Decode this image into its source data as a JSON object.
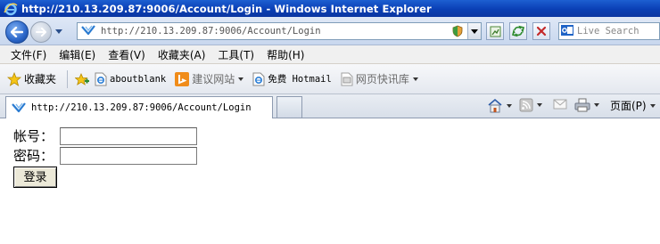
{
  "window": {
    "title": "http://210.13.209.87:9006/Account/Login - Windows Internet Explorer"
  },
  "address_bar": {
    "url": "http://210.13.209.87:9006/Account/Login"
  },
  "search": {
    "placeholder": "Live Search"
  },
  "menu": {
    "items": [
      "文件(F)",
      "编辑(E)",
      "查看(V)",
      "收藏夹(A)",
      "工具(T)",
      "帮助(H)"
    ]
  },
  "favorites_bar": {
    "favorites_label": "收藏夹",
    "items": [
      {
        "label": "aboutblank",
        "icon": "ie-page-icon"
      },
      {
        "label": "建议网站",
        "icon": "bing-icon"
      },
      {
        "label": "免费 Hotmail",
        "icon": "ie-page-icon"
      },
      {
        "label": "网页快讯库",
        "icon": "webslice-icon"
      }
    ]
  },
  "tabs": [
    {
      "title": "http://210.13.209.87:9006/Account/Login"
    }
  ],
  "command_bar": {
    "page_label": "页面(P)"
  },
  "login_form": {
    "username_label": "帐号：",
    "username_value": "",
    "password_label": "密码：",
    "password_value": "",
    "submit_label": "登录"
  }
}
